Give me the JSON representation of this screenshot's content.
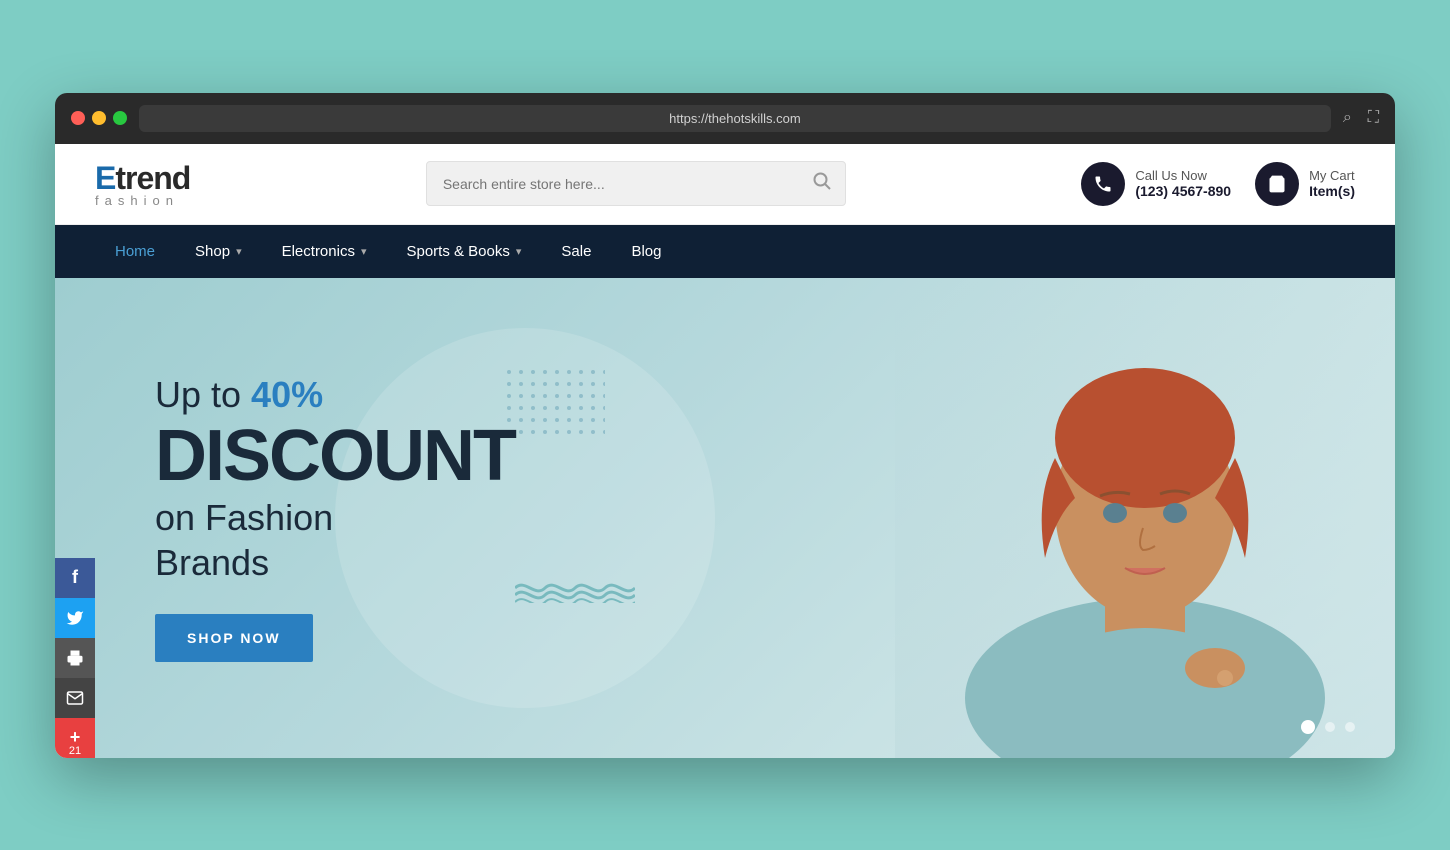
{
  "browser": {
    "url": "https://thehotskills.com",
    "search_icon": "🔍",
    "fullscreen_icon": "⛶"
  },
  "header": {
    "logo": {
      "prefix": "E",
      "name": "trend",
      "tagline": "fashion"
    },
    "search": {
      "placeholder": "Search entire store here...",
      "button_label": "🔍"
    },
    "phone": {
      "label": "Call Us Now",
      "number": "(123) 4567-890"
    },
    "cart": {
      "label": "My Cart",
      "items": "Item(s)"
    }
  },
  "nav": {
    "items": [
      {
        "label": "Home",
        "active": true,
        "has_dropdown": false
      },
      {
        "label": "Shop",
        "active": false,
        "has_dropdown": true
      },
      {
        "label": "Electronics",
        "active": false,
        "has_dropdown": true
      },
      {
        "label": "Sports & Books",
        "active": false,
        "has_dropdown": true
      },
      {
        "label": "Sale",
        "active": false,
        "has_dropdown": false
      },
      {
        "label": "Blog",
        "active": false,
        "has_dropdown": false
      }
    ]
  },
  "hero": {
    "line1_prefix": "Up to ",
    "line1_highlight": "40%",
    "line2": "DISCOUNT",
    "line3": "on Fashion",
    "line4": "Brands",
    "cta_label": "SHOP NOW",
    "slider_dots": [
      {
        "active": true
      },
      {
        "active": false
      },
      {
        "active": false
      }
    ]
  },
  "social": {
    "buttons": [
      {
        "label": "f",
        "name": "facebook",
        "class": "social-facebook"
      },
      {
        "label": "🐦",
        "name": "twitter",
        "class": "social-twitter"
      },
      {
        "label": "🖨",
        "name": "print",
        "class": "social-print"
      },
      {
        "label": "✉",
        "name": "email",
        "class": "social-email"
      },
      {
        "label": "+",
        "name": "plus",
        "count": "21",
        "class": "social-plus"
      }
    ]
  }
}
